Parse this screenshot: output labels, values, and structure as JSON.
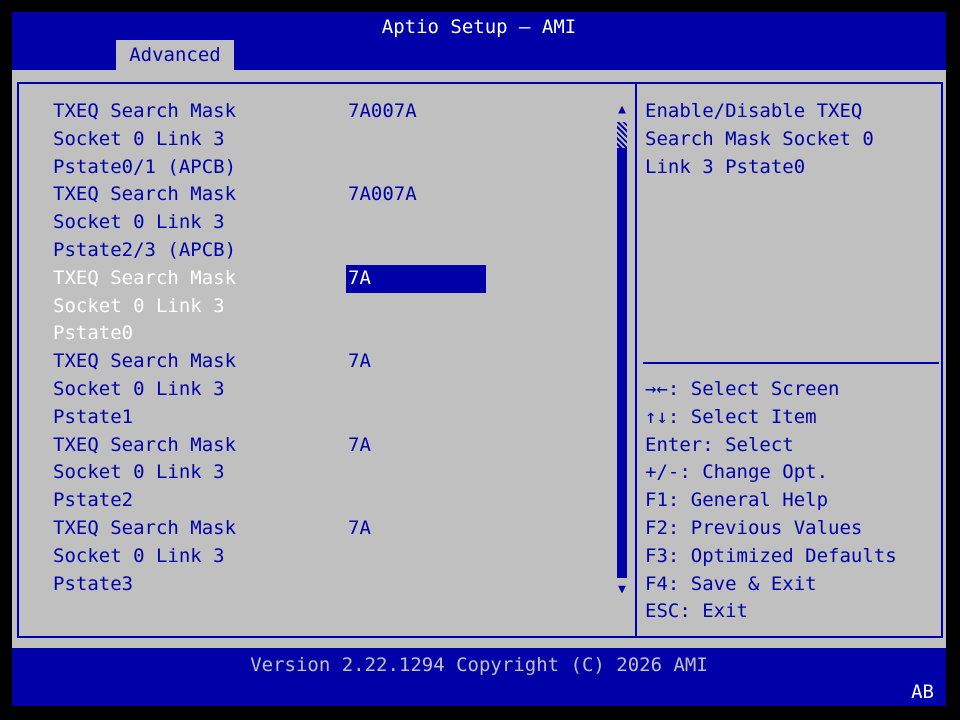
{
  "header": {
    "title": "Aptio Setup – AMI",
    "tabs": [
      {
        "label": "Advanced"
      }
    ]
  },
  "settings": [
    {
      "lines": [
        "TXEQ Search Mask",
        "Socket 0 Link 3",
        "Pstate0/1 (APCB)"
      ],
      "value": "7A007A",
      "selected": false
    },
    {
      "lines": [
        "TXEQ Search Mask",
        "Socket 0 Link 3",
        "Pstate2/3 (APCB)"
      ],
      "value": "7A007A",
      "selected": false
    },
    {
      "lines": [
        "TXEQ Search Mask",
        "Socket 0 Link 3",
        "Pstate0"
      ],
      "value": "7A",
      "selected": true
    },
    {
      "lines": [
        "TXEQ Search Mask",
        "Socket 0 Link 3",
        "Pstate1"
      ],
      "value": "7A",
      "selected": false
    },
    {
      "lines": [
        "TXEQ Search Mask",
        "Socket 0 Link 3",
        "Pstate2"
      ],
      "value": "7A",
      "selected": false
    },
    {
      "lines": [
        "TXEQ Search Mask",
        "Socket 0 Link 3",
        "Pstate3"
      ],
      "value": "7A",
      "selected": false
    }
  ],
  "help": {
    "text": "Enable/Disable TXEQ\nSearch Mask Socket 0\nLink 3 Pstate0"
  },
  "keys": [
    "→←: Select Screen",
    "↑↓: Select Item",
    "Enter: Select",
    "+/-: Change Opt.",
    "F1: General Help",
    "F2: Previous Values",
    "F3: Optimized Defaults",
    "F4: Save & Exit",
    "ESC: Exit"
  ],
  "scrollbar": {
    "up_glyph": "▲",
    "down_glyph": "▼"
  },
  "footer": {
    "version": "Version 2.22.1294 Copyright (C) 2026 AMI",
    "badge": "AB"
  },
  "colors": {
    "blue": "#0000a8",
    "gray": "#c0c0c0",
    "white": "#ffffff"
  }
}
